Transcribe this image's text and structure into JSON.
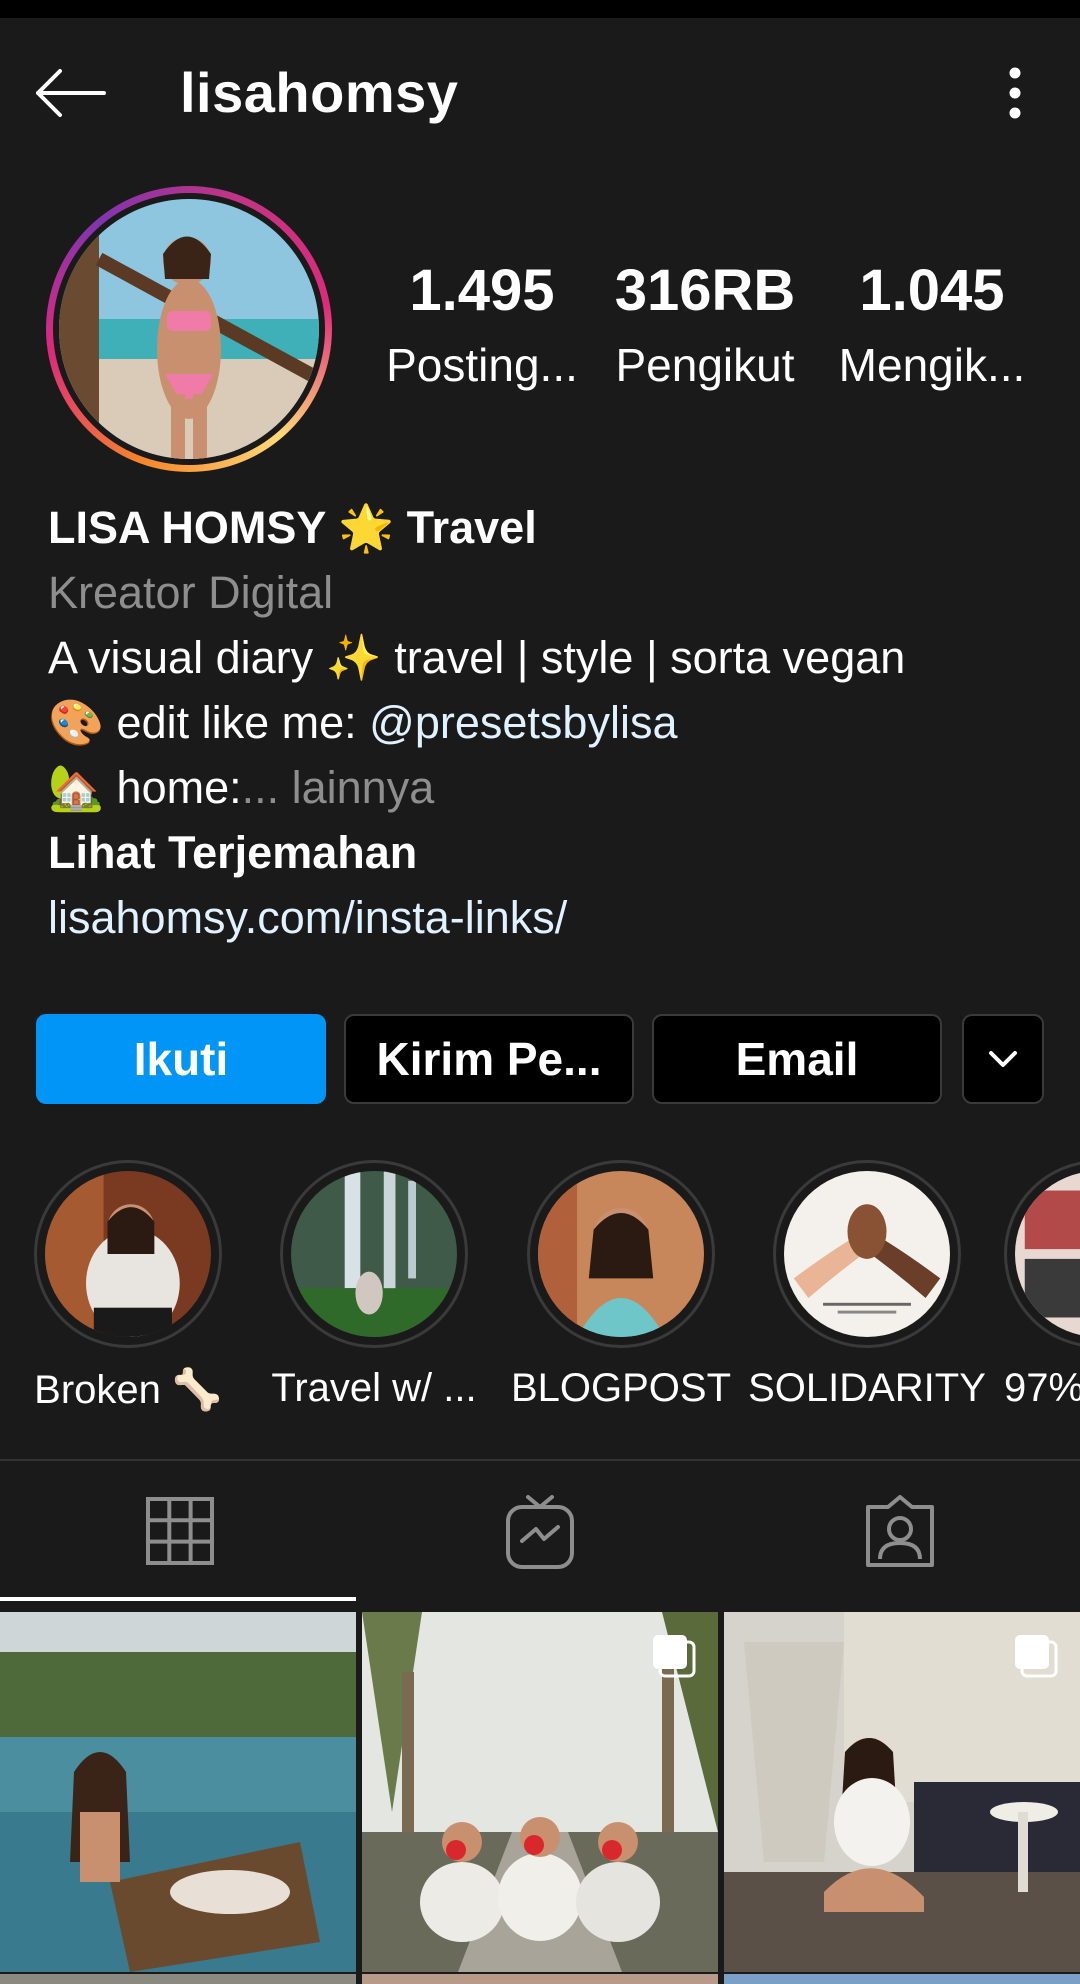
{
  "header": {
    "username": "lisahomsy"
  },
  "stats": {
    "posts": {
      "value": "1.495",
      "label": "Posting..."
    },
    "followers": {
      "value": "316RB",
      "label": "Pengikut"
    },
    "following": {
      "value": "1.045",
      "label": "Mengik..."
    }
  },
  "bio": {
    "name": "LISA HOMSY",
    "name_emoji": "🌟",
    "name_suffix": "Travel",
    "category": "Kreator Digital",
    "line1_prefix": "A visual diary",
    "line1_emoji": "✨",
    "line1_suffix": "travel | style | sorta vegan",
    "line2_emoji": "🎨",
    "line2_text": "edit like me:",
    "line2_mention": "@presetsbylisa",
    "line3_emoji": "🏡",
    "line3_text": "home:",
    "line3_more": "... lainnya",
    "translate": "Lihat Terjemahan",
    "website": "lisahomsy.com/insta-links/"
  },
  "actions": {
    "follow": "Ikuti",
    "message": "Kirim Pe...",
    "email": "Email"
  },
  "highlights": [
    {
      "label": "Broken 🦴"
    },
    {
      "label": "Travel w/ ..."
    },
    {
      "label": "BLOGPOST"
    },
    {
      "label": "SOLIDARITY"
    },
    {
      "label": "97%"
    }
  ],
  "tabs": [
    {
      "icon": "grid-icon"
    },
    {
      "icon": "igtv-icon"
    },
    {
      "icon": "tagged-icon"
    }
  ],
  "colors": {
    "background": "#1a1a1a",
    "follow_button": "#0095f6",
    "link": "#e0f1ff",
    "muted": "#8e8e8e"
  }
}
